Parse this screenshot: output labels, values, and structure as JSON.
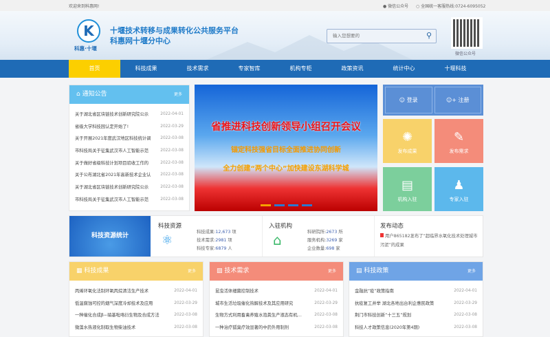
{
  "topbar": {
    "welcome": "欢迎来到科惠网!",
    "wechat": "微信公众号",
    "hotline": "全国统一客服热线:0724-6095052"
  },
  "header": {
    "logo_caption": "科惠·十堰",
    "title_line1": "十堰技术转移与成果转化公共服务平台",
    "title_line2": "科惠网十堰分中心",
    "search_placeholder": "输入您想要的",
    "qr_caption": "微信公众号"
  },
  "nav": {
    "items": [
      "首页",
      "科技成果",
      "技术需求",
      "专家智库",
      "机构专柜",
      "政策资讯",
      "统计中心",
      "十堰科技"
    ]
  },
  "notice": {
    "title": "通知公告",
    "more": "更多",
    "items": [
      {
        "t": "关于湖北省区块链技术创新研究院公示",
        "d": "2022-04-01"
      },
      {
        "t": "省级大学科技园认定开始了!",
        "d": "2022-03-29"
      },
      {
        "t": "关于开展2021年度武汉地区科技统计调",
        "d": "2022-03-08"
      },
      {
        "t": "市科技局关于征集武汉市人工智能示范",
        "d": "2022-03-08"
      },
      {
        "t": "关于做好省级科技计划项目验收工作的",
        "d": "2022-03-08"
      },
      {
        "t": "关于公布湖北省2021年高新技术企业认",
        "d": "2022-03-08"
      },
      {
        "t": "关于湖北省区块链技术创新研究院公示",
        "d": "2022-03-08"
      },
      {
        "t": "市科技局关于征集武汉市人工智能示范",
        "d": "2022-03-08"
      }
    ]
  },
  "banner": {
    "headline": "省推进科技创新领导小组召开会议",
    "line2": "锚定科技强省目标全面推进协同创新",
    "line3": "全力创建“两个中心”加快建设东湖科学城",
    "slide_count": 4,
    "active_slide": 1
  },
  "auth": {
    "login": "登录",
    "register": "注册"
  },
  "tiles": [
    {
      "label": "发布成果",
      "color": "#f8d26a",
      "icon": "lightbulb-icon"
    },
    {
      "label": "发布需求",
      "color": "#f48c7a",
      "icon": "edit-document-icon"
    },
    {
      "label": "机构入驻",
      "color": "#7ccf9c",
      "icon": "building-icon"
    },
    {
      "label": "专家入驻",
      "color": "#5cb8ec",
      "icon": "graduate-icon"
    }
  ],
  "stats": {
    "banner": "科技资源统计",
    "resources": {
      "title": "科技资源",
      "lines": [
        {
          "k": "科技成果:",
          "v": "12,673",
          "u": "项"
        },
        {
          "k": "技术需求:",
          "v": "2981",
          "u": "项"
        },
        {
          "k": "科技专家:",
          "v": "6879",
          "u": "人"
        }
      ]
    },
    "institutions": {
      "title": "入驻机构",
      "lines": [
        {
          "k": "科研院所:",
          "v": "2673",
          "u": "所"
        },
        {
          "k": "服务机构:",
          "v": "3269",
          "u": "家"
        },
        {
          "k": "企业数量:",
          "v": "698",
          "u": "家"
        }
      ]
    },
    "activity": {
      "title": "发布动态",
      "text": "用户865182发布了“超临界水氧化技术处理城市污泥”的成果"
    }
  },
  "achievements": {
    "title": "科技成果",
    "more": "更多",
    "color": "#f8d26a",
    "items": [
      {
        "t": "丙烯环氧化法制环氧丙烷清洁生产技术",
        "d": "2022-04-01"
      },
      {
        "t": "低温腐蚀可控的烟气深度冷却技术及应用",
        "d": "2022-03-29"
      },
      {
        "t": "一种催化合成β−硝基吡咯衍生物及合成方法",
        "d": "2022-03-08"
      },
      {
        "t": "微藻水热液化制取生物柴油技术",
        "d": "2022-03-08"
      }
    ]
  },
  "demands": {
    "title": "技术需求",
    "more": "更多",
    "color": "#f48c7a",
    "items": [
      {
        "t": "昆虫活体细菌控制技术",
        "d": "2022-04-01"
      },
      {
        "t": "城市生活垃圾催化热解技术及其应用研究",
        "d": "2022-03-29"
      },
      {
        "t": "生物方式利用畜禽养殖水泡粪生产液态有机肥...",
        "d": "2022-03-08"
      },
      {
        "t": "一种治疗狐臭疗效显著的中药外用制剂",
        "d": "2022-03-08"
      }
    ]
  },
  "policy": {
    "title": "科技政策",
    "more": "更多",
    "color": "#6fa4e6",
    "items": [
      {
        "t": "金融抗“疫”政策指南",
        "d": "2022-04-01"
      },
      {
        "t": "抗疫复工并举 湖北各地出台利企惠民政策",
        "d": "2022-03-29"
      },
      {
        "t": "荆门市科技创新“十三五”规划",
        "d": "2022-03-08"
      },
      {
        "t": "科技人才政策信息(2020年第4期)",
        "d": "2022-03-08"
      }
    ]
  }
}
